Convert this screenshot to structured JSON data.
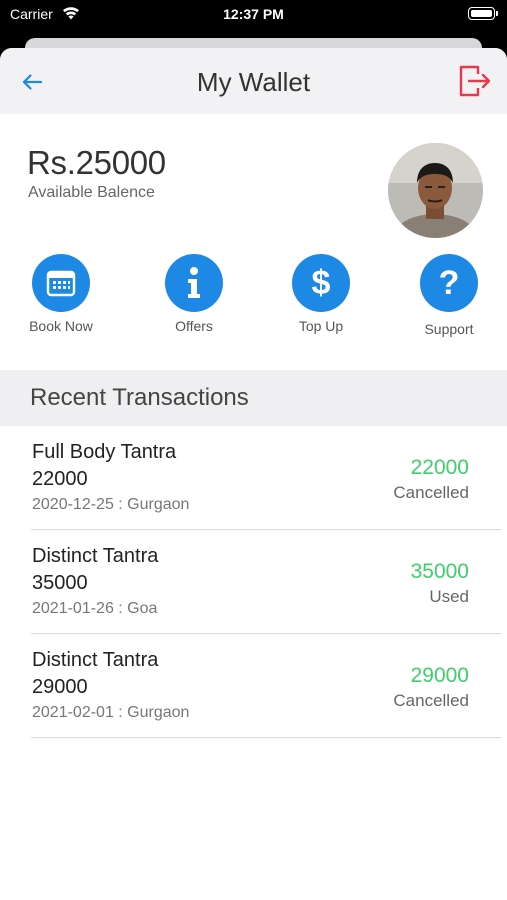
{
  "status_bar": {
    "carrier": "Carrier",
    "time": "12:37 PM"
  },
  "nav": {
    "title": "My Wallet",
    "back_icon": "arrow-left-icon",
    "logout_icon": "logout-icon",
    "accent_color": "#1e88e5",
    "logout_color": "#e53950"
  },
  "wallet": {
    "amount": "Rs.25000",
    "label": "Available Balence"
  },
  "actions": [
    {
      "label": "Book Now",
      "icon": "calendar-icon"
    },
    {
      "label": "Offers",
      "icon": "info-icon"
    },
    {
      "label": "Top Up",
      "icon": "dollar-icon"
    },
    {
      "label": "Support",
      "icon": "question-icon"
    }
  ],
  "recent": {
    "title": "Recent Transactions",
    "items": [
      {
        "name": "Full Body Tantra",
        "amount": "22000",
        "meta": "2020-12-25 : Gurgaon",
        "value": "22000",
        "status": "Cancelled"
      },
      {
        "name": "Distinct Tantra",
        "amount": "35000",
        "meta": "2021-01-26 : Goa",
        "value": "35000",
        "status": "Used"
      },
      {
        "name": "Distinct Tantra",
        "amount": "29000",
        "meta": "2021-02-01 : Gurgaon",
        "value": "29000",
        "status": "Cancelled"
      }
    ],
    "value_color": "#3ecf6b"
  }
}
